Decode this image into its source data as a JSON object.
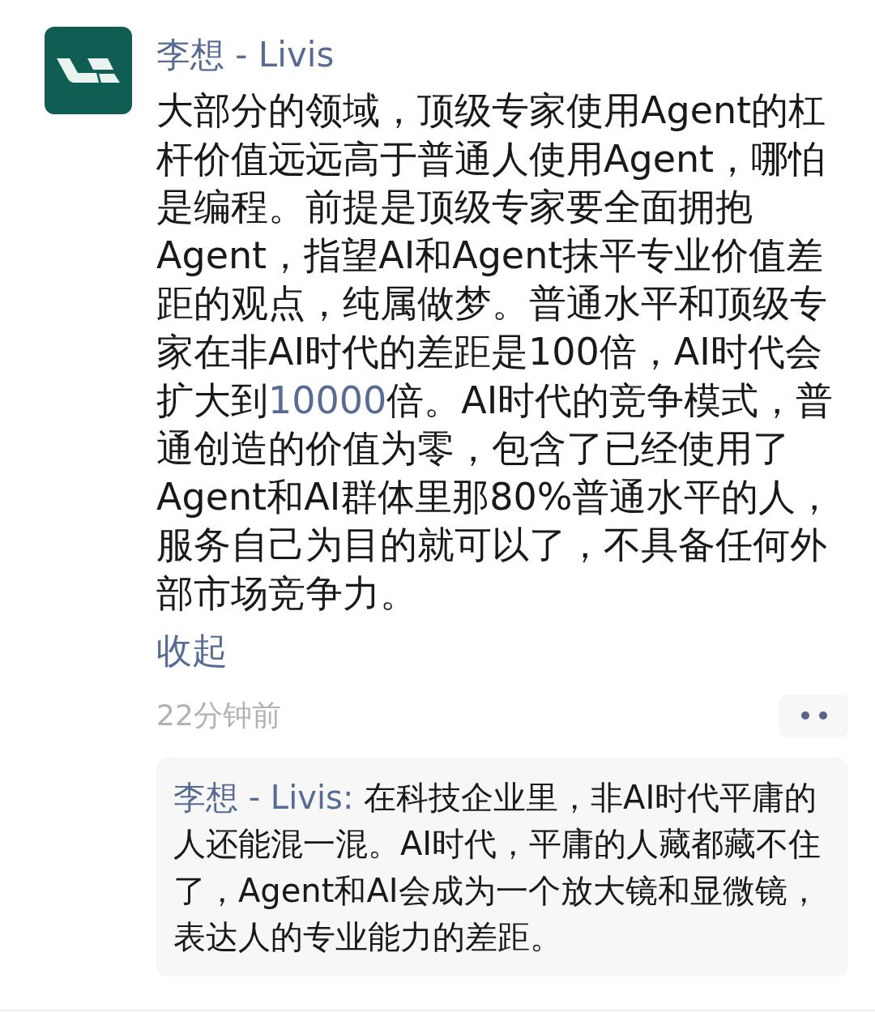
{
  "post": {
    "author": "李想 - Livis",
    "body": [
      {
        "kind": "text",
        "text": "大部分的领域，顶级专家使用Agent的杠杆价值远远高于普通人使用Agent，哪怕是编程。前提是顶级专家要全面拥抱Agent，指望AI和Agent抹平专业价值差距的观点，纯属做梦。普通水平和顶级专家在非AI时代的差距是100倍，AI时代会扩大到"
      },
      {
        "kind": "link",
        "text": "10000"
      },
      {
        "kind": "text",
        "text": "倍。AI时代的竞争模式，普通创造的价值为零，包含了已经使用了Agent和AI群体里那80%普通水平的人，服务自己为目的就可以了，不具备任何外部市场竞争力。"
      }
    ],
    "collapse_link": "收起",
    "time": "22分钟前"
  },
  "comments": [
    {
      "author": "李想 - Livis:",
      "text": " 在科技企业里，非AI时代平庸的人还能混一混。AI时代，平庸的人藏都藏不住了，Agent和AI会成为一个放大镜和显微镜，表达人的专业能力的差距。"
    }
  ]
}
